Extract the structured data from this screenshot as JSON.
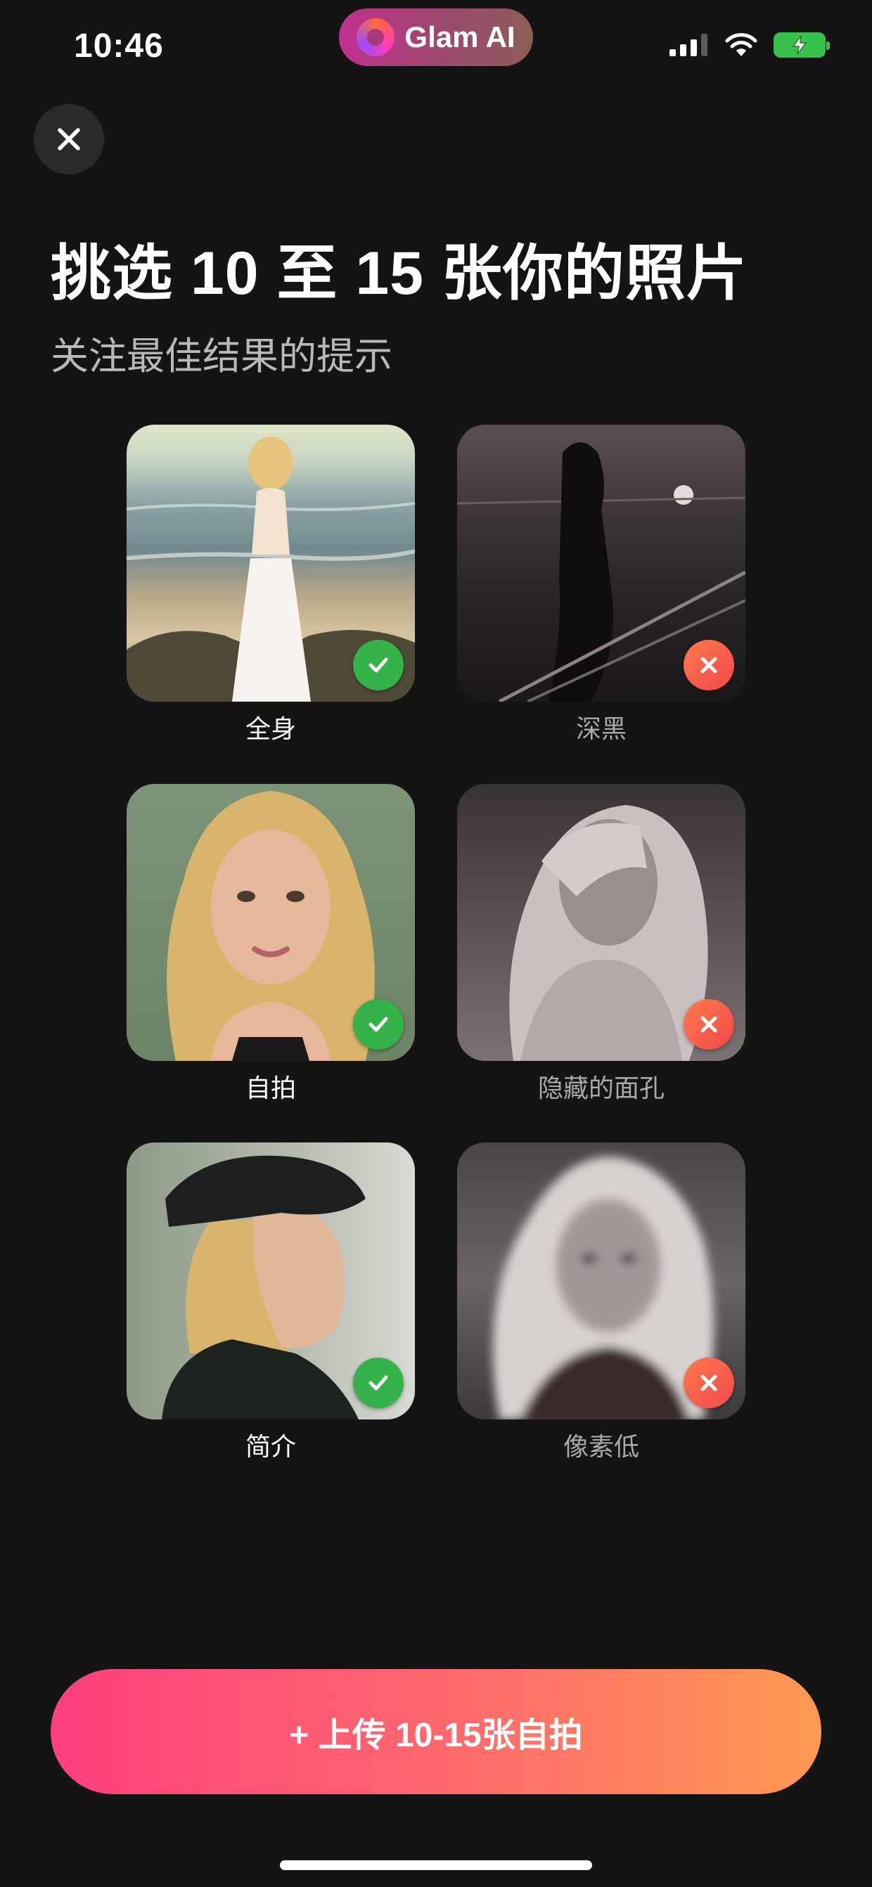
{
  "status_bar": {
    "time": "10:46",
    "app_pill": {
      "name": "Glam AI"
    },
    "icons": [
      "cellular-signal-icon",
      "wifi-icon",
      "battery-charging-icon"
    ]
  },
  "header": {
    "close_icon": "close-icon",
    "title": "挑选 10 至 15 张你的照片",
    "subtitle": "关注最佳结果的提示"
  },
  "examples": [
    {
      "label": "全身",
      "status": "good"
    },
    {
      "label": "深黑",
      "status": "bad"
    },
    {
      "label": "自拍",
      "status": "good"
    },
    {
      "label": "隐藏的面孔",
      "status": "bad"
    },
    {
      "label": "简介",
      "status": "good"
    },
    {
      "label": "像素低",
      "status": "bad"
    }
  ],
  "cta": {
    "label": "+ 上传 10-15张自拍"
  },
  "colors": {
    "background": "#141414",
    "good_badge": "#35b24a",
    "bad_badge": "#f2484a",
    "cta_start": "#ff3f7f",
    "cta_end": "#ff9a52"
  }
}
